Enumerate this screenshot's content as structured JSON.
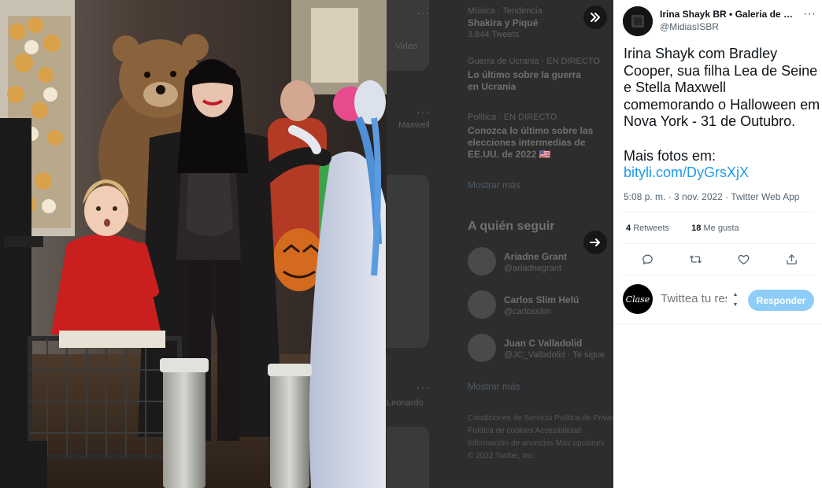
{
  "tweet": {
    "author_name": "Irina Shayk BR • Galeria de Fotos",
    "author_handle": "@MidiasISBR",
    "text_line1": "Irina Shayk com Bradley Cooper, sua filha Lea de Seine e Stella Maxwell comemorando o Halloween em Nova York - 31 de Outubro.",
    "text_line2_prefix": "Mais fotos em:",
    "link_text": "bityli.com/DyGrsXjX",
    "timestamp": "5:08 p. m. · 3 nov. 2022 · Twitter Web App",
    "retweets_count": "4",
    "retweets_label": "Retweets",
    "likes_count": "18",
    "likes_label": "Me gusta"
  },
  "reply": {
    "avatar_text": "Clase",
    "placeholder": "Twittea tu respuesta",
    "button_label": "Responder"
  },
  "background": {
    "trend1_category": "Música · Tendencia",
    "trend1_title": "Shakira y Piqué",
    "trend1_count": "3.844 Tweets",
    "trend2_category": "Guerra de Ucrania · EN DIRECTO",
    "trend2_title": "Lo último sobre la guerra en Ucrania",
    "trend3_category": "Política · EN DIRECTO",
    "trend3_title": "Conozca lo último sobre las elecciones intermedias de EE.UU. de 2022 🇺🇸",
    "show_more_1": "Mostrar más",
    "who_to_follow": "A quién seguir",
    "follow1_name": "Ariadne Grant",
    "follow1_handle": "@ariadnegrant",
    "follow2_name": "Carlos Slim Helú",
    "follow2_handle": "@carlosslim",
    "follow3_name": "Juan C Valladolid",
    "follow3_handle": "@JC_Valladolid · Te sigue",
    "show_more_2": "Mostrar más",
    "footer1": "Condiciones de Servicio   Política de Privacidad",
    "footer2": "Política de cookies   Accesibilidad",
    "footer3": "Información de anuncios   Más opciones",
    "footer4": "© 2022 Twitter, Inc.",
    "side_label1": "Video",
    "side_label2": "Maxwell",
    "side_label3": "Leonardo"
  },
  "icons": {
    "collapse": "double-chevron-right-icon",
    "next": "arrow-right-icon",
    "reply": "reply-icon",
    "retweet": "retweet-icon",
    "like": "heart-icon",
    "share": "share-icon",
    "more": "more-icon"
  },
  "colors": {
    "accent": "#1d9bf0",
    "reply_button": "#8ecdf8",
    "text": "#0f1419",
    "muted": "#536471"
  }
}
